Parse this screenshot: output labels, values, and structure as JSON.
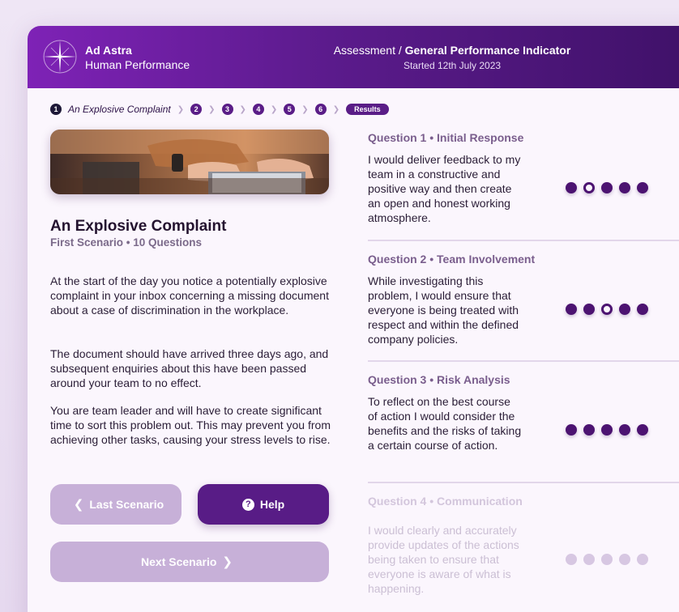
{
  "header": {
    "brand_name": "Ad Astra",
    "brand_sub": "Human Performance",
    "breadcrumb_prefix": "Assessment / ",
    "breadcrumb_current": "General Performance Indicator",
    "started": "Started 12th July 2023"
  },
  "progress": {
    "current_step": "1",
    "current_label": "An Explosive Complaint",
    "steps": [
      "2",
      "3",
      "4",
      "5",
      "6"
    ],
    "results_label": "Results"
  },
  "scenario": {
    "title": "An Explosive Complaint",
    "subtitle": "First Scenario • 10 Questions",
    "paragraphs": [
      "At the start of the day you notice a potentially explosive complaint in your inbox concerning a missing document about a case of discrimination in the workplace.",
      "The document should have arrived three days ago, and subsequent enquiries about this have been passed around your team to no effect.",
      "You are team leader and will have to create significant time to sort this problem out. This may prevent you from achieving other tasks, causing your stress levels to rise."
    ]
  },
  "buttons": {
    "last": "Last Scenario",
    "help": "Help",
    "next": "Next Scenario"
  },
  "questions": [
    {
      "title": "Question 1 • Initial Response",
      "text": "I would deliver feedback to my team in a constructive and positive way and then create an open and honest working atmosphere.",
      "rating": 2,
      "scale": 5,
      "enabled": true
    },
    {
      "title": "Question 2 • Team Involvement",
      "text": "While investigating this problem, I would ensure that everyone is being treated with respect and within the defined company policies.",
      "rating": 3,
      "scale": 5,
      "enabled": true
    },
    {
      "title": "Question 3 •  Risk Analysis",
      "text": "To reflect on the best course of action I would consider the benefits and the risks of taking a certain course of action.",
      "rating": 0,
      "scale": 5,
      "enabled": true
    },
    {
      "title": "Question 4 • Communication",
      "text": "I would clearly and accurately provide updates of the actions being taken to ensure that everyone is aware of what is happening.",
      "rating": 0,
      "scale": 5,
      "enabled": false
    }
  ],
  "colors": {
    "accent": "#581c86",
    "header_start": "#7e22b6",
    "header_end": "#3f1168",
    "disabled_button": "#c7b0d8"
  }
}
